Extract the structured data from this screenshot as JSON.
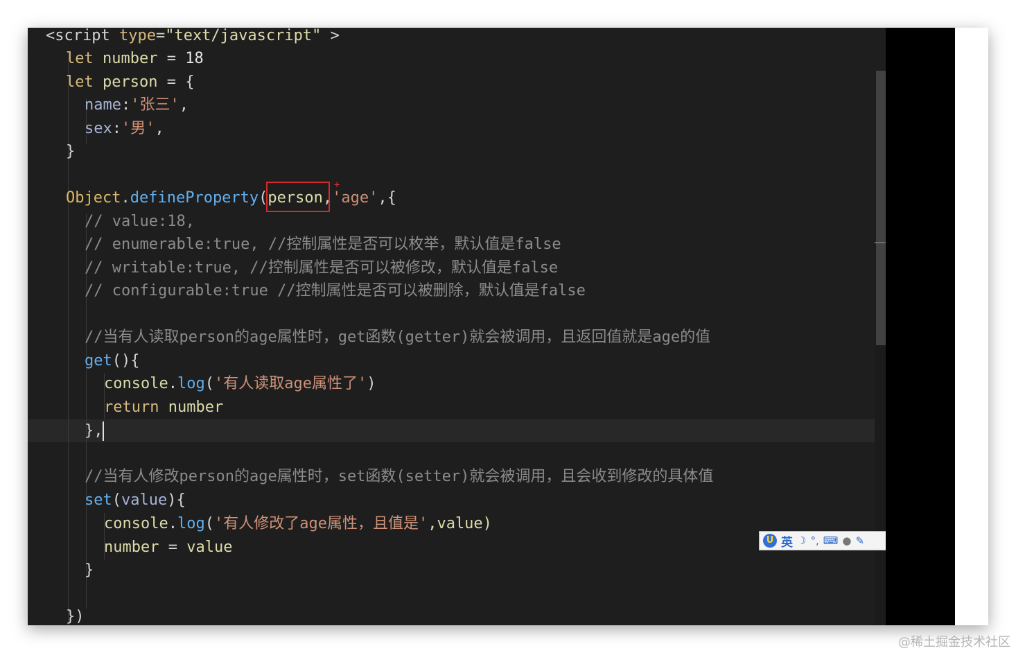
{
  "code": {
    "l1": {
      "tag_open": "<script",
      "type_attr": "type",
      "eq": "=",
      "type_val": "\"text/javascript\"",
      "tag_close": " >"
    },
    "l2": {
      "kw": "let",
      "name": "number",
      "eq": " = ",
      "val": "18"
    },
    "l3": {
      "kw": "let",
      "name": "person",
      "rest": " = {"
    },
    "l4": {
      "key": "name",
      "colon": ":",
      "val": "'张三'",
      "comma": ","
    },
    "l5": {
      "key": "sex",
      "colon": ":",
      "val": "'男'",
      "comma": ","
    },
    "l6": {
      "text": "}"
    },
    "l7": {
      "obj": "Object",
      "dot": ".",
      "method": "defineProperty",
      "paren": "(",
      "arg": "person",
      "comma": ",",
      "str": "'age'",
      "rest": ",{"
    },
    "l8": {
      "text": "// value:18,"
    },
    "l9": {
      "text": "// enumerable:true, //控制属性是否可以枚举，默认值是false"
    },
    "l10": {
      "text": "// writable:true, //控制属性是否可以被修改，默认值是false"
    },
    "l11": {
      "text": "// configurable:true //控制属性是否可以被删除，默认值是false"
    },
    "l12": {
      "text": "//当有人读取person的age属性时，get函数(getter)就会被调用，且返回值就是age的值"
    },
    "l13": {
      "fn": "get",
      "rest": "(){"
    },
    "l14": {
      "obj": "console",
      "dot": ".",
      "method": "log",
      "open": "(",
      "str": "'有人读取age属性了'",
      "close": ")"
    },
    "l15": {
      "kw": "return",
      "val": " number"
    },
    "l16": {
      "text": "},"
    },
    "l17": {
      "text": "//当有人修改person的age属性时，set函数(setter)就会被调用，且会收到修改的具体值"
    },
    "l18": {
      "fn": "set",
      "open": "(",
      "param": "value",
      "close": "){"
    },
    "l19": {
      "obj": "console",
      "dot": ".",
      "method": "log",
      "open": "(",
      "str": "'有人修改了age属性，且值是'",
      "rest": ",value)"
    },
    "l20": {
      "name": "number",
      "eq": " = ",
      "val": "value"
    },
    "l21": {
      "text": "}"
    },
    "l22": {
      "text": "})"
    }
  },
  "ime": {
    "logo": "U",
    "lang": "英",
    "moon_icon": "☽",
    "punct_icon": "°,",
    "keyboard_icon": "⌨",
    "user_icon": "●",
    "tool_icon": "✎"
  },
  "watermark": "@稀土掘金技术社区",
  "colors": {
    "keyword": "#d7ba7d",
    "function": "#61afef",
    "string": "#ce9178",
    "comment": "#8b8b8b",
    "highlight_box": "#d42a2a"
  }
}
